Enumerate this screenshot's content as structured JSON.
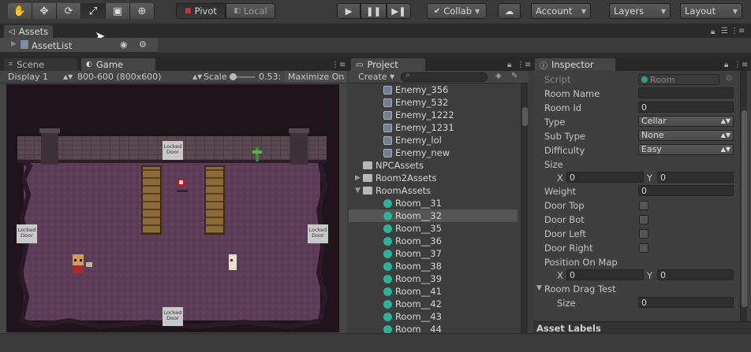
{
  "toolbar": {
    "tools": [
      "hand-icon",
      "move-icon",
      "rotate-icon",
      "scale-icon",
      "rect-icon",
      "transform-icon"
    ],
    "pivot_label": "Pivot",
    "local_label": "Local",
    "collab_label": "Collab",
    "account_label": "Account",
    "layers_label": "Layers",
    "layout_label": "Layout"
  },
  "assets_tab": {
    "label": "Assets"
  },
  "assetlist_bar": {
    "label": "AssetList"
  },
  "scene_tab": {
    "label": "Scene"
  },
  "game_tab": {
    "label": "Game"
  },
  "game_toolbar": {
    "display": "Display 1",
    "resolution": "800-600 (800x600)",
    "scale_label": "Scale",
    "scale_value": "0.53:",
    "maximize": "Maximize On P"
  },
  "game": {
    "doors": [
      "Locked Door",
      "Locked Door",
      "Locked Door",
      "Locked Door"
    ]
  },
  "project": {
    "tab": "Project",
    "create_label": "Create",
    "rows": [
      {
        "indent": 1,
        "icon": "script",
        "label": "Enemy_356",
        "sel": false,
        "fold": ""
      },
      {
        "indent": 1,
        "icon": "script",
        "label": "Enemy_532",
        "sel": false,
        "fold": ""
      },
      {
        "indent": 1,
        "icon": "script",
        "label": "Enemy_1222",
        "sel": false,
        "fold": ""
      },
      {
        "indent": 1,
        "icon": "script",
        "label": "Enemy_1231",
        "sel": false,
        "fold": ""
      },
      {
        "indent": 1,
        "icon": "script",
        "label": "Enemy_lol",
        "sel": false,
        "fold": ""
      },
      {
        "indent": 1,
        "icon": "script",
        "label": "Enemy_new",
        "sel": false,
        "fold": ""
      },
      {
        "indent": 0,
        "icon": "folder",
        "label": "NPCAssets",
        "sel": false,
        "fold": ""
      },
      {
        "indent": 0,
        "icon": "folder",
        "label": "Room2Assets",
        "sel": false,
        "fold": "▶"
      },
      {
        "indent": 0,
        "icon": "folder",
        "label": "RoomAssets",
        "sel": false,
        "fold": "▼"
      },
      {
        "indent": 1,
        "icon": "room",
        "label": "Room__31",
        "sel": false,
        "fold": ""
      },
      {
        "indent": 1,
        "icon": "room",
        "label": "Room__32",
        "sel": true,
        "fold": ""
      },
      {
        "indent": 1,
        "icon": "room",
        "label": "Room__35",
        "sel": false,
        "fold": ""
      },
      {
        "indent": 1,
        "icon": "room",
        "label": "Room__36",
        "sel": false,
        "fold": ""
      },
      {
        "indent": 1,
        "icon": "room",
        "label": "Room__37",
        "sel": false,
        "fold": ""
      },
      {
        "indent": 1,
        "icon": "room",
        "label": "Room__38",
        "sel": false,
        "fold": ""
      },
      {
        "indent": 1,
        "icon": "room",
        "label": "Room__39",
        "sel": false,
        "fold": ""
      },
      {
        "indent": 1,
        "icon": "room",
        "label": "Room__41",
        "sel": false,
        "fold": ""
      },
      {
        "indent": 1,
        "icon": "room",
        "label": "Room__42",
        "sel": false,
        "fold": ""
      },
      {
        "indent": 1,
        "icon": "room",
        "label": "Room__43",
        "sel": false,
        "fold": ""
      },
      {
        "indent": 1,
        "icon": "room",
        "label": "Room__44",
        "sel": false,
        "fold": ""
      }
    ]
  },
  "inspector": {
    "tab": "Inspector",
    "script_label": "Script",
    "script_value": "Room",
    "room_name_label": "Room Name",
    "room_name_value": "",
    "room_id_label": "Room Id",
    "room_id_value": "0",
    "type_label": "Type",
    "type_value": "Cellar",
    "subtype_label": "Sub Type",
    "subtype_value": "None",
    "difficulty_label": "Difficulty",
    "difficulty_value": "Easy",
    "size_label": "Size",
    "x_label": "X",
    "y_label": "Y",
    "size_x": "0",
    "size_y": "0",
    "weight_label": "Weight",
    "weight_value": "0",
    "door_top_label": "Door Top",
    "door_bot_label": "Door Bot",
    "door_left_label": "Door Left",
    "door_right_label": "Door Right",
    "position_label": "Position On Map",
    "pos_x": "0",
    "pos_y": "0",
    "drag_test_label": "Room Drag Test",
    "drag_size_label": "Size",
    "drag_size_value": "0",
    "asset_labels": "Asset Labels"
  }
}
